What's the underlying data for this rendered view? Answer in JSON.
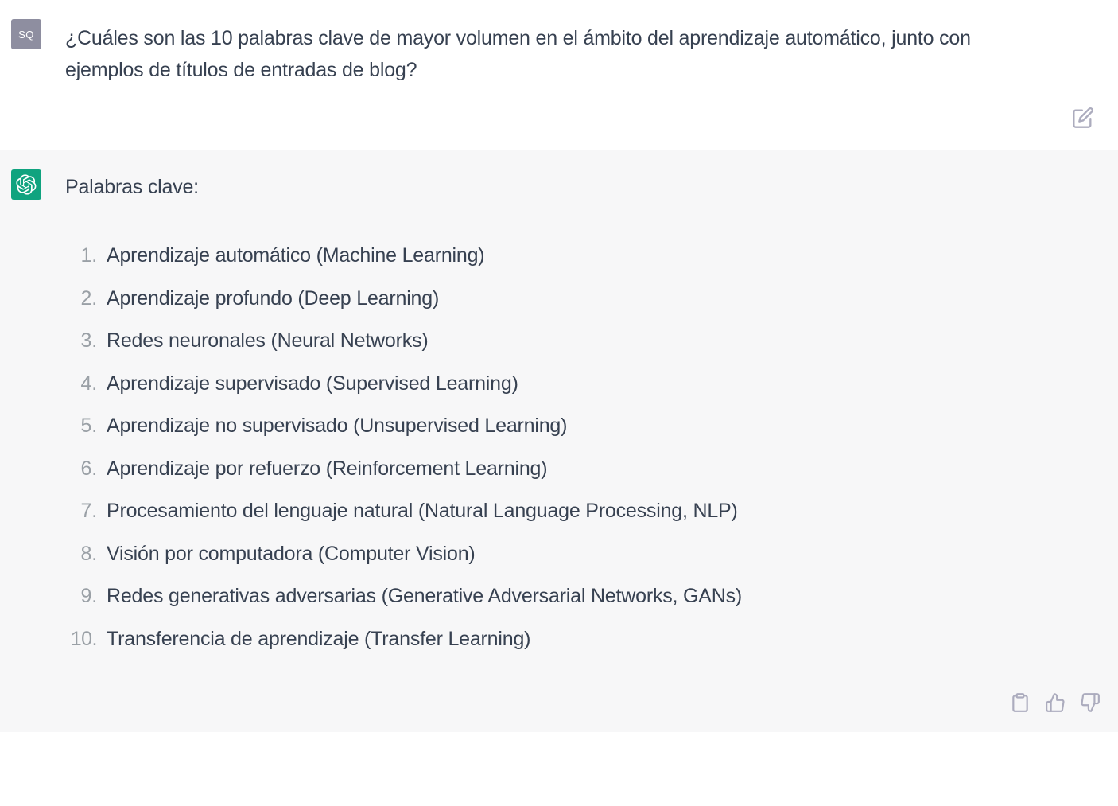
{
  "user": {
    "avatar_initials": "SQ",
    "prompt": "¿Cuáles son las 10 palabras clave de mayor volumen en el ámbito del aprendizaje automático, junto con ejemplos de títulos de entradas de blog?"
  },
  "assistant": {
    "heading": "Palabras clave:",
    "keywords": [
      "Aprendizaje automático (Machine Learning)",
      "Aprendizaje profundo (Deep Learning)",
      "Redes neuronales (Neural Networks)",
      "Aprendizaje supervisado (Supervised Learning)",
      "Aprendizaje no supervisado (Unsupervised Learning)",
      "Aprendizaje por refuerzo (Reinforcement Learning)",
      "Procesamiento del lenguaje natural (Natural Language Processing, NLP)",
      "Visión por computadora (Computer Vision)",
      "Redes generativas adversarias (Generative Adversarial Networks, GANs)",
      "Transferencia de aprendizaje (Transfer Learning)"
    ]
  },
  "icons": {
    "edit": "edit-icon",
    "copy": "clipboard-icon",
    "thumbs_up": "thumbs-up-icon",
    "thumbs_down": "thumbs-down-icon",
    "assistant_logo": "openai-logo-icon"
  }
}
